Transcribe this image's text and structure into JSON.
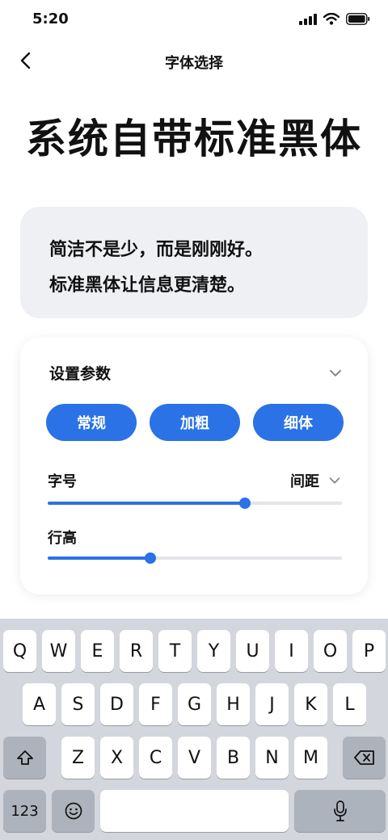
{
  "status_bar": {
    "time": "5:20"
  },
  "nav": {
    "title": "字体选择"
  },
  "page_title": "系统自带标准黑体",
  "preview": {
    "lines": [
      "简洁不是少，而是刚刚好。",
      "标准黑体让信息更清楚。"
    ]
  },
  "settings": {
    "title": "设置参数",
    "style_buttons": [
      "常规",
      "加粗",
      "细体"
    ],
    "font_size_label": "字号",
    "spacing_label": "间距",
    "font_size_value": 0.67,
    "line_height_label": "行高",
    "line_height_value": 0.35
  },
  "keyboard": {
    "row1": [
      "Q",
      "W",
      "E",
      "R",
      "T",
      "Y",
      "U",
      "I",
      "O",
      "P"
    ],
    "row2": [
      "A",
      "S",
      "D",
      "F",
      "G",
      "H",
      "J",
      "K",
      "L"
    ],
    "row3": [
      "Z",
      "X",
      "C",
      "V",
      "B",
      "N",
      "M"
    ],
    "numbers_key": "123"
  },
  "colors": {
    "accent": "#2a72e6",
    "keyboard_bg": "#d3d6dc",
    "card_bg": "#eef0f3"
  }
}
